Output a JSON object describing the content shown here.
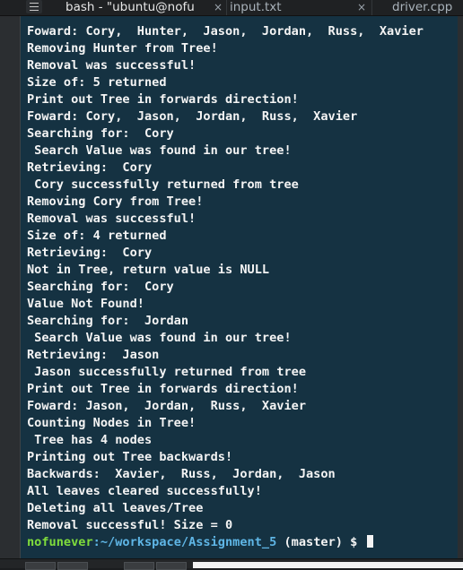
{
  "tabs": [
    {
      "label": "bash - \"ubuntu@nofu",
      "close": "×",
      "active": true
    },
    {
      "label": "input.txt",
      "close": "×",
      "active": false
    },
    {
      "label": "driver.cpp",
      "close": "",
      "active": false
    }
  ],
  "terminal": {
    "lines": [
      "Foward: Cory,  Hunter,  Jason,  Jordan,  Russ,  Xavier",
      "Removing Hunter from Tree!",
      "Removal was successful!",
      "Size of: 5 returned",
      "Print out Tree in forwards direction!",
      "Foward: Cory,  Jason,  Jordan,  Russ,  Xavier",
      "Searching for:  Cory",
      " Search Value was found in our tree!",
      "Retrieving:  Cory",
      " Cory successfully returned from tree",
      "Removing Cory from Tree!",
      "Removal was successful!",
      "Size of: 4 returned",
      "Retrieving:  Cory",
      "Not in Tree, return value is NULL",
      "Searching for:  Cory",
      "Value Not Found!",
      "Searching for:  Jordan",
      " Search Value was found in our tree!",
      "Retrieving:  Jason",
      " Jason successfully returned from tree",
      "Print out Tree in forwards direction!",
      "Foward: Jason,  Jordan,  Russ,  Xavier",
      "Counting Nodes in Tree!",
      " Tree has 4 nodes",
      "Printing out Tree backwards!",
      "Backwards:  Xavier,  Russ,  Jordan,  Jason",
      "All leaves cleared successfully!",
      "Deleting all leaves/Tree",
      "Removal successful! Size = 0"
    ],
    "prompt": {
      "user": "nofunever",
      "path": ":~/workspace/Assignment_5",
      "rest": " (master) $ "
    }
  },
  "colors": {
    "terminal_bg": "#153242",
    "prompt_user": "#7fdc3c",
    "prompt_path": "#5fb6e6"
  }
}
